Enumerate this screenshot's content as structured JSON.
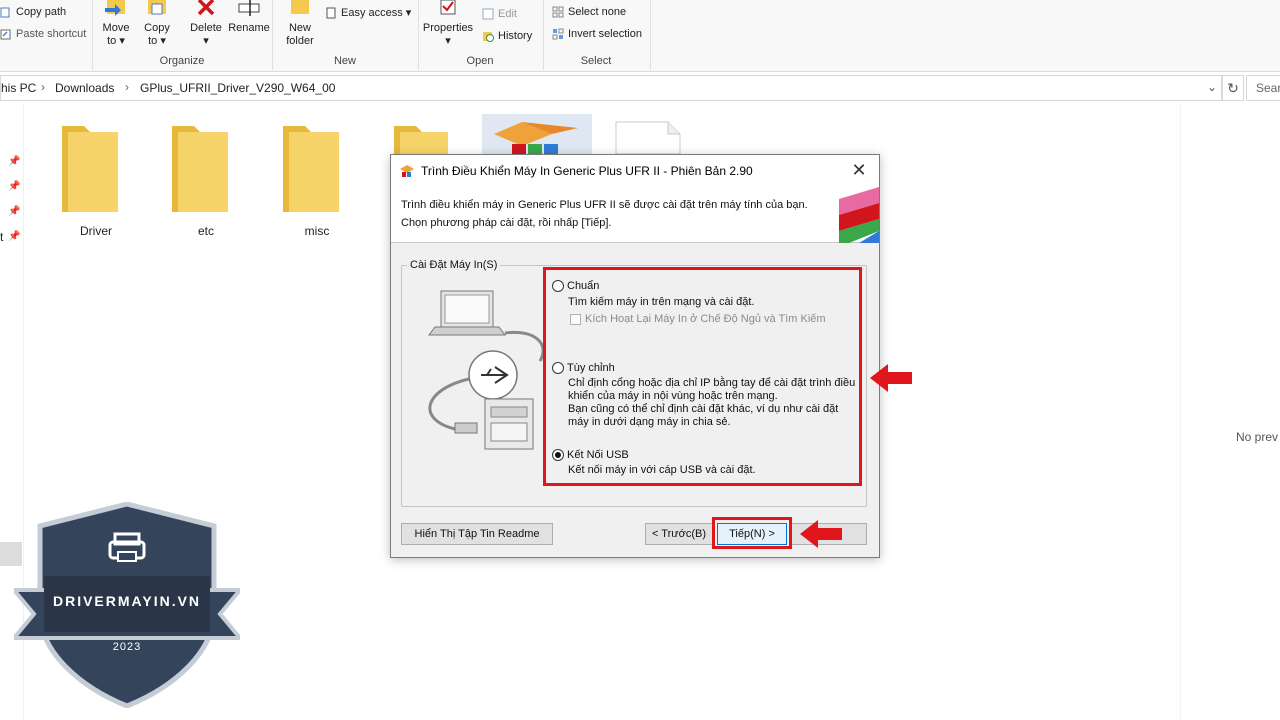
{
  "ribbon": {
    "clipboard": {
      "copy_path": "Copy path",
      "paste_shortcut": "Paste shortcut"
    },
    "organize": {
      "move_to": "Move\nto ▾",
      "copy_to": "Copy\nto ▾",
      "delete": "Delete\n▾",
      "rename": "Rename",
      "group_label": "Organize"
    },
    "new": {
      "new_folder": "New\nfolder",
      "easy_access": "Easy access ▾",
      "group_label": "New"
    },
    "open": {
      "properties": "Properties\n▾",
      "edit": "Edit",
      "history": "History",
      "group_label": "Open"
    },
    "select": {
      "select_none": "Select none",
      "invert_selection": "Invert selection",
      "group_label": "Select"
    }
  },
  "address_bar": {
    "crumbs": [
      "his PC",
      "Downloads",
      "GPlus_UFRII_Driver_V290_W64_00"
    ],
    "search_placeholder": "Sear"
  },
  "files": [
    {
      "name": "Driver",
      "type": "folder"
    },
    {
      "name": "etc",
      "type": "folder"
    },
    {
      "name": "misc",
      "type": "folder"
    }
  ],
  "nav_pane": {
    "partial_label": "t"
  },
  "preview": {
    "no_preview": "No prev"
  },
  "dialog": {
    "title": "Trình Điều Khiển Máy In Generic Plus UFR II - Phiên Bản 2.90",
    "intro_line1": "Trình điều khiển máy in Generic Plus UFR II sẽ được cài đặt trên máy tính của bạn.",
    "intro_line2": "Chọn phương pháp cài đặt, rồi nhấp [Tiếp].",
    "group_label": "Cài Đặt Máy In(S)",
    "options": [
      {
        "label": "Chuẩn",
        "desc_lines": [
          "Tìm kiếm máy in trên mạng và cài đặt."
        ],
        "checked": false
      },
      {
        "label": "Tùy chỉnh",
        "desc_lines": [
          "Chỉ định cổng hoặc địa chỉ IP bằng tay để cài đặt trình điều",
          "khiển của máy in nội vùng hoặc trên mạng.",
          "Bạn cũng có thể chỉ định cài đặt khác, ví dụ như cài đặt",
          "máy in dưới dạng máy in chia sẻ."
        ],
        "checked": false
      },
      {
        "label": "Kết Nối USB",
        "desc_lines": [
          "Kết nối máy in với cáp USB và cài đặt."
        ],
        "checked": true
      }
    ],
    "sleep_checkbox": "Kích Hoạt Lại Máy In ở Chế Độ Ngủ và Tìm Kiếm",
    "readme_button": "Hiển Thị Tập Tin Readme",
    "back_button": "< Trước(B)",
    "next_button": "Tiếp(N) >",
    "cancel_button": ""
  },
  "watermark": {
    "brand": "DRIVERMAYIN.VN",
    "year": "2023"
  },
  "colors": {
    "highlight_red": "#e0161c",
    "folder_yellow": "#f5c94d",
    "badge_navy": "#34445a"
  }
}
